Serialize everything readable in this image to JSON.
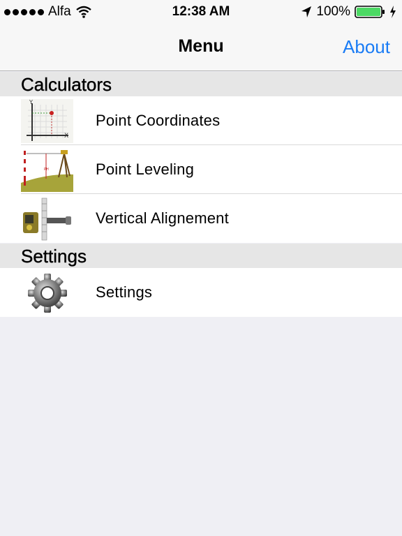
{
  "status_bar": {
    "carrier": "Alfa",
    "time": "12:38 AM",
    "battery": "100%",
    "battery_level": 1.0,
    "icons": [
      "signal-dots-icon",
      "wifi-icon",
      "location-arrow-icon",
      "battery-icon",
      "charging-bolt-icon"
    ]
  },
  "navbar": {
    "title": "Menu",
    "right_button": "About"
  },
  "sections": [
    {
      "header": "Calculators",
      "items": [
        {
          "label": "Point Coordinates",
          "icon": "point-coordinates-icon"
        },
        {
          "label": "Point Leveling",
          "icon": "point-leveling-icon"
        },
        {
          "label": "Vertical Alignement",
          "icon": "vertical-alignement-icon"
        }
      ]
    },
    {
      "header": "Settings",
      "items": [
        {
          "label": "Settings",
          "icon": "gear-icon"
        }
      ]
    }
  ],
  "colors": {
    "accent": "#1a7cf5",
    "background": "#efeff4",
    "section_header": "#e6e6e6",
    "battery_fill": "#4cd964"
  }
}
